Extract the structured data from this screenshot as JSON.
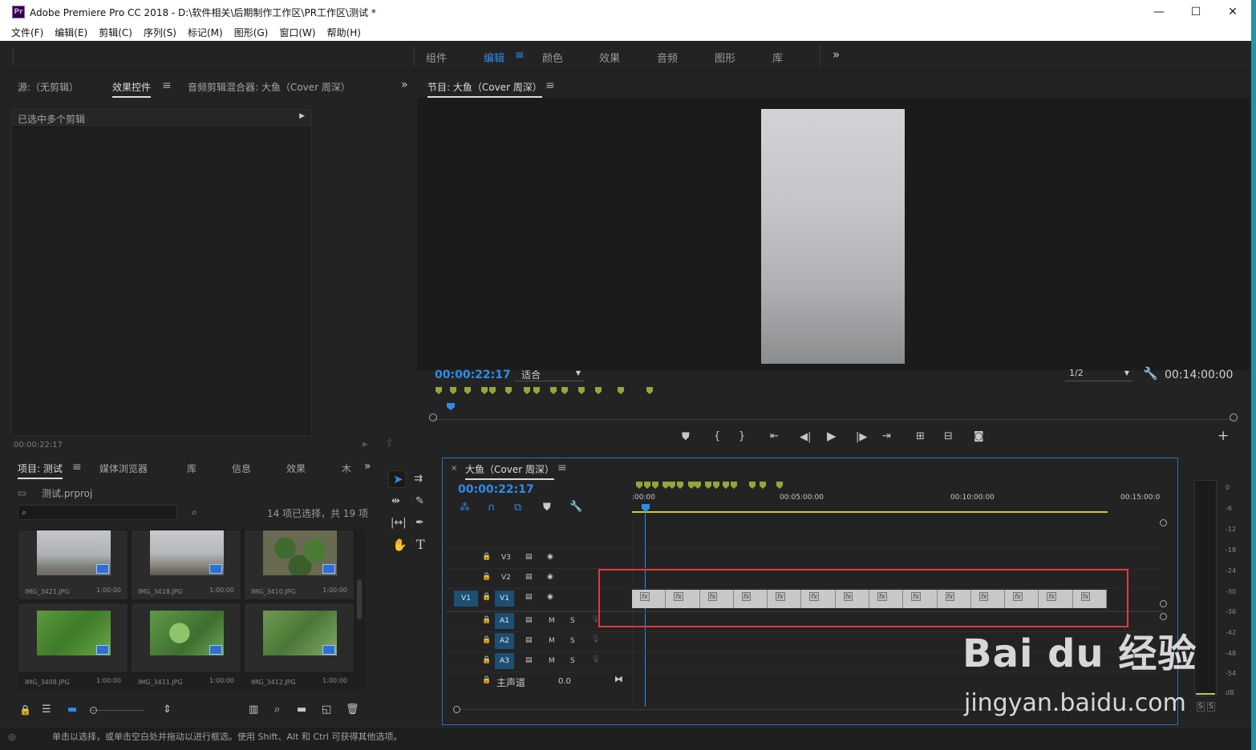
{
  "app": {
    "title": "Adobe Premiere Pro CC 2018 - D:\\软件相关\\后期制作工作区\\PR工作区\\测试 *",
    "logo": "Pr",
    "minimize": "—",
    "maximize": "☐",
    "close": "✕"
  },
  "menu": [
    "文件(F)",
    "编辑(E)",
    "剪辑(C)",
    "序列(S)",
    "标记(M)",
    "图形(G)",
    "窗口(W)",
    "帮助(H)"
  ],
  "workspaces": [
    "组件",
    "编辑",
    "颜色",
    "效果",
    "音频",
    "图形",
    "库"
  ],
  "workspace_active": "编辑",
  "workspace_overflow": "»",
  "source_panel": {
    "tabs": [
      "源:（无剪辑）",
      "效果控件",
      "音频剪辑混合器: 大鱼（Cover 周深）"
    ],
    "active_tab": "效果控件",
    "header": "已选中多个剪辑",
    "timecode": "00:00:22:17"
  },
  "program_monitor": {
    "title": "节目: 大鱼（Cover 周深）",
    "timecode": "00:00:22:17",
    "fit": "适合",
    "resolution": "1/2",
    "duration": "00:14:00:00"
  },
  "project_panel": {
    "tabs": [
      "项目: 测试",
      "媒体浏览器",
      "库",
      "信息",
      "效果",
      "⽊"
    ],
    "active_tab": "项目: 测试",
    "project_file": "测试.prproj",
    "search_placeholder": "",
    "selection_info": "14 项已选择，共 19 项",
    "items": [
      {
        "name": "IMG_3421.JPG",
        "duration": "1:00:00"
      },
      {
        "name": "IMG_3418.JPG",
        "duration": "1:00:00"
      },
      {
        "name": "IMG_3410.JPG",
        "duration": "1:00:00"
      },
      {
        "name": "IMG_3408.JPG",
        "duration": "1:00:00"
      },
      {
        "name": "IMG_3411.JPG",
        "duration": "1:00:00"
      },
      {
        "name": "IMG_3412.JPG",
        "duration": "1:00:00"
      }
    ]
  },
  "timeline": {
    "title": "大鱼（Cover 周深）",
    "timecode": "00:00:22:17",
    "ruler": [
      ":00:00",
      "00:05:00:00",
      "00:10:00:00",
      "00:15:00:0"
    ],
    "tracks": {
      "video": [
        "V3",
        "V2",
        "V1"
      ],
      "audio": [
        "A1",
        "A2",
        "A3"
      ],
      "source_patch": "V1",
      "mute": "M",
      "solo": "S",
      "master_label": "主声道",
      "master_value": "0.0"
    },
    "clip_count": 14,
    "fx_label": "fx"
  },
  "audio_meter": {
    "ticks": [
      "0",
      "-6",
      "-12",
      "-18",
      "-24",
      "-30",
      "-36",
      "-42",
      "-48",
      "-54",
      "dB"
    ],
    "solo_left": "S",
    "solo_right": "S"
  },
  "statusbar": {
    "text": "单击以选择，或单击空白处并拖动以进行框选。使用 Shift、Alt 和 Ctrl 可获得其他选项。"
  },
  "watermark": {
    "brand": "Bai du 经验",
    "url": "jingyan.baidu.com"
  },
  "colors": {
    "accent": "#2d8ceb",
    "marker": "#8fa83a",
    "highlight": "#e03a3a",
    "track_blue": "#1d4f73"
  }
}
